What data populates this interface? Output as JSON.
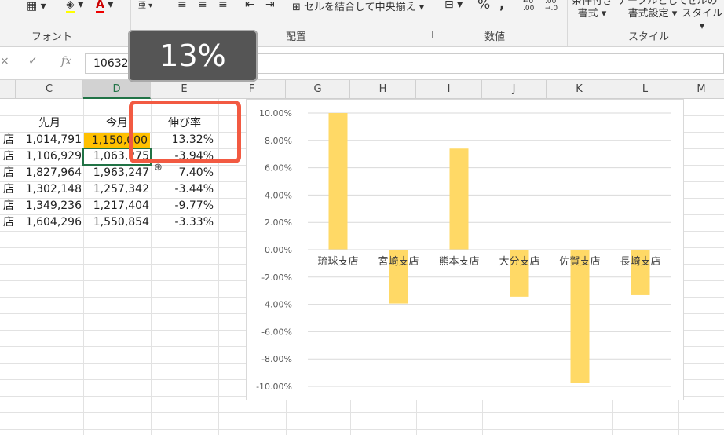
{
  "ribbon": {
    "groups": {
      "font": "フォント",
      "alignment": "配置",
      "number": "数値",
      "styles": "スタイル"
    },
    "merge_label": "セルを結合して中央揃え",
    "percent_symbol": "%",
    "comma_symbol": ",",
    "styles_buttons": [
      {
        "line1": "条件付き",
        "line2": "書式"
      },
      {
        "line1": "テーブルとして",
        "line2": "書式設定"
      },
      {
        "line1": "セルの",
        "line2": "スタイル"
      }
    ]
  },
  "formula_bar": {
    "fx": "fx",
    "value": "1063275"
  },
  "tooltip": "13%",
  "columns": [
    "C",
    "D",
    "E",
    "F",
    "G",
    "H",
    "I",
    "J",
    "K",
    "L",
    "M"
  ],
  "table": {
    "headers": {
      "prev": "先月",
      "curr": "今月",
      "growth": "伸び率"
    },
    "rows": [
      {
        "label_end": "店",
        "prev": "1,014,791",
        "curr": "1,150,000",
        "growth": "13.32%"
      },
      {
        "label_end": "店",
        "prev": "1,106,929",
        "curr": "1,063,275",
        "growth": "-3.94%"
      },
      {
        "label_end": "店",
        "prev": "1,827,964",
        "curr": "1,963,247",
        "growth": "7.40%"
      },
      {
        "label_end": "店",
        "prev": "1,302,148",
        "curr": "1,257,342",
        "growth": "-3.44%"
      },
      {
        "label_end": "店",
        "prev": "1,349,236",
        "curr": "1,217,404",
        "growth": "-9.77%"
      },
      {
        "label_end": "店",
        "prev": "1,604,296",
        "curr": "1,550,854",
        "growth": "-3.33%"
      }
    ]
  },
  "chart_data": {
    "type": "bar",
    "categories": [
      "琉球支店",
      "宮崎支店",
      "熊本支店",
      "大分支店",
      "佐賀支店",
      "長崎支店"
    ],
    "values": [
      13.32,
      -3.94,
      7.4,
      -3.44,
      -9.77,
      -3.33
    ],
    "ylim": [
      -10,
      10
    ],
    "yticks": [
      "10.00%",
      "8.00%",
      "6.00%",
      "4.00%",
      "2.00%",
      "0.00%",
      "-2.00%",
      "-4.00%",
      "-6.00%",
      "-8.00%",
      "-10.00%"
    ],
    "bar_color": "#ffd966",
    "grid": true
  }
}
